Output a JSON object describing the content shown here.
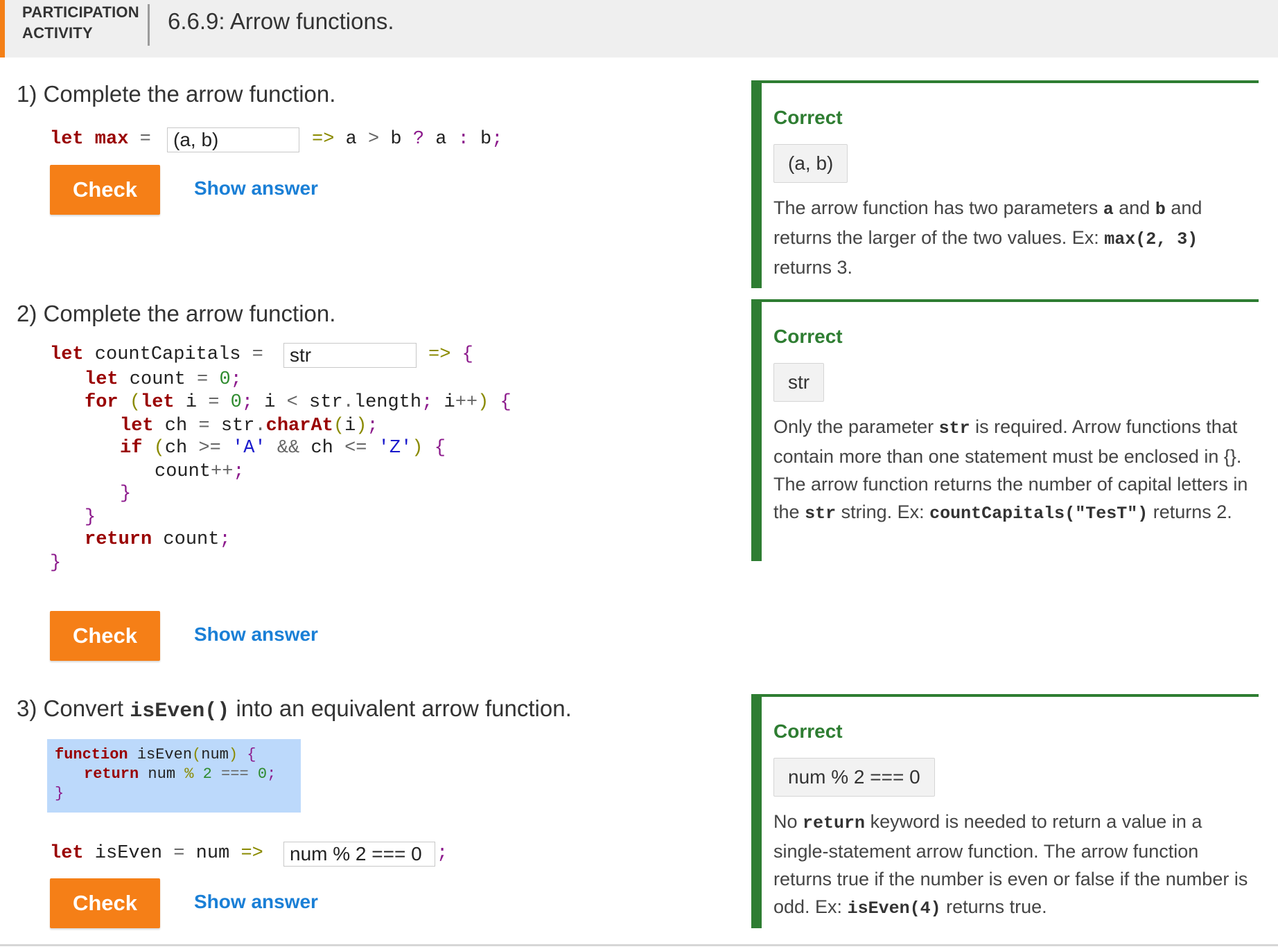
{
  "header": {
    "activity_type_line1": "PARTICIPATION",
    "activity_type_line2": "ACTIVITY",
    "title": "6.6.9: Arrow functions."
  },
  "questions": [
    {
      "number": "1)",
      "prompt": "Complete the arrow function.",
      "input_value": "(a, b)",
      "check_label": "Check",
      "show_answer_label": "Show answer"
    },
    {
      "number": "2)",
      "prompt": "Complete the arrow function.",
      "input_value": "str",
      "check_label": "Check",
      "show_answer_label": "Show answer"
    },
    {
      "number": "3)",
      "prompt_before": "Convert",
      "prompt_code": "isEven()",
      "prompt_after": "into an equivalent arrow function.",
      "input_value": "num % 2 === 0",
      "check_label": "Check",
      "show_answer_label": "Show answer"
    }
  ],
  "feedback": [
    {
      "status": "Correct",
      "answer": "(a, b)",
      "text": {
        "t1": "The arrow function has two parameters",
        "c1": "a",
        "t2": "and",
        "c2": "b",
        "t3": "and returns the larger of the two values. Ex:",
        "c3": "max(2, 3)",
        "t4": "returns 3."
      }
    },
    {
      "status": "Correct",
      "answer": "str",
      "text": {
        "t1": "Only the parameter",
        "c1": "str",
        "t2": "is required. Arrow functions that contain more than one statement must be enclosed in {}. The arrow function returns the number of capital letters in the",
        "c2": "str",
        "t3": "string. Ex:",
        "c3": "countCapitals(\"TesT\")",
        "t4": "returns 2."
      }
    },
    {
      "status": "Correct",
      "answer": "num % 2 === 0",
      "text": {
        "t1": "No",
        "c1": "return",
        "t2": "keyword is needed to return a value in a single-statement arrow function. The arrow function returns true if the number is even or false if the number is odd. Ex:",
        "c2": "isEven(4)",
        "t3": "returns true."
      }
    }
  ]
}
